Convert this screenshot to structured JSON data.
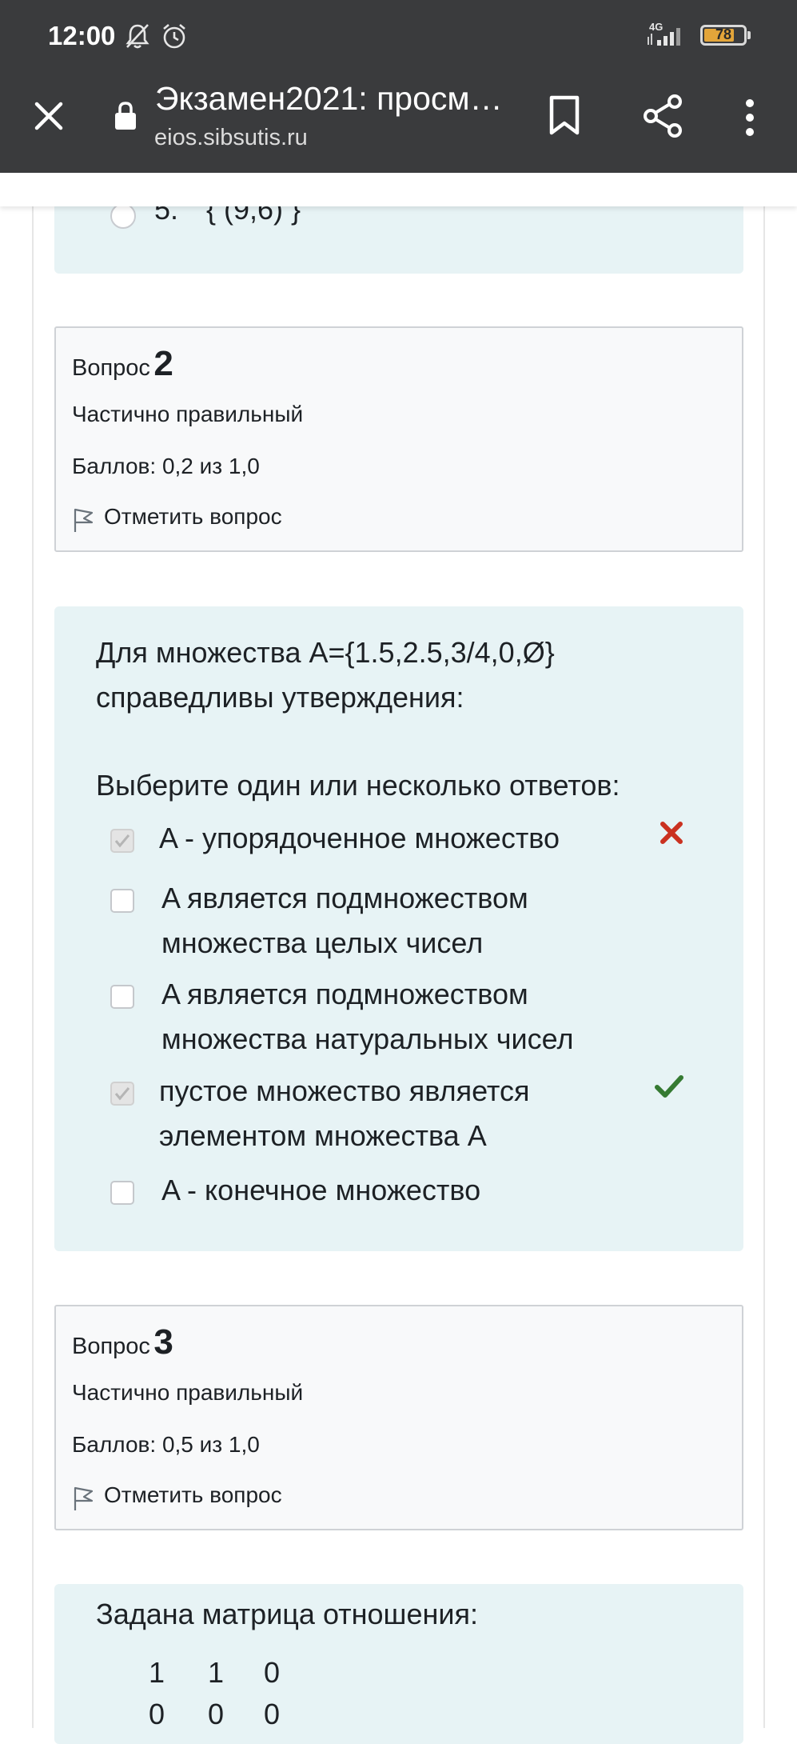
{
  "status_bar": {
    "time": "12:00",
    "network": "4G",
    "battery": "78",
    "battery_level": 0.78
  },
  "toolbar": {
    "title": "Экзамен2021: просм…",
    "url": "eios.sibsutis.ru"
  },
  "prev_answer": {
    "number": "5.",
    "text": "{ (9,6) }"
  },
  "question2": {
    "label": "Вопрос",
    "number": "2",
    "state": "Частично правильный",
    "grade": "Баллов: 0,2 из 1,0",
    "flag_label": "Отметить вопрос",
    "text_line1": "Для множества A={1.5,2.5,3/4,0,Ø}",
    "text_line2": "справедливы утверждения:",
    "prompt": "Выберите один или несколько ответов:",
    "answers": [
      {
        "line1": "A - упорядоченное множество",
        "line2": "",
        "checked": true,
        "mark": "incorrect"
      },
      {
        "line1": "A является подмножеством",
        "line2": "множества целых чисел",
        "checked": false,
        "mark": ""
      },
      {
        "line1": "A является подмножеством",
        "line2": "множества натуральных чисел",
        "checked": false,
        "mark": ""
      },
      {
        "line1": "пустое множество является",
        "line2": "элементом множества A",
        "checked": true,
        "mark": "correct"
      },
      {
        "line1": "A - конечное множество",
        "line2": "",
        "checked": false,
        "mark": ""
      }
    ]
  },
  "question3": {
    "label": "Вопрос",
    "number": "3",
    "state": "Частично правильный",
    "grade": "Баллов: 0,5 из 1,0",
    "flag_label": "Отметить вопрос",
    "text": "Задана матрица отношения:",
    "matrix": [
      [
        "1",
        "1",
        "0"
      ],
      [
        "0",
        "0",
        "0"
      ]
    ]
  },
  "colors": {
    "bar": "#3a3b3d",
    "qtext_bg": "#e7f3f5",
    "info_bg": "#f8f9fa",
    "incorrect": "#ca3120",
    "correct": "#357a32",
    "battery": "#e3a53a"
  },
  "icons": [
    "bell-off-icon",
    "alarm-icon",
    "signal-icon",
    "battery-icon",
    "close-icon",
    "lock-icon",
    "bookmark-icon",
    "share-icon",
    "more-vert-icon",
    "flag-icon",
    "cross-icon",
    "check-icon"
  ]
}
